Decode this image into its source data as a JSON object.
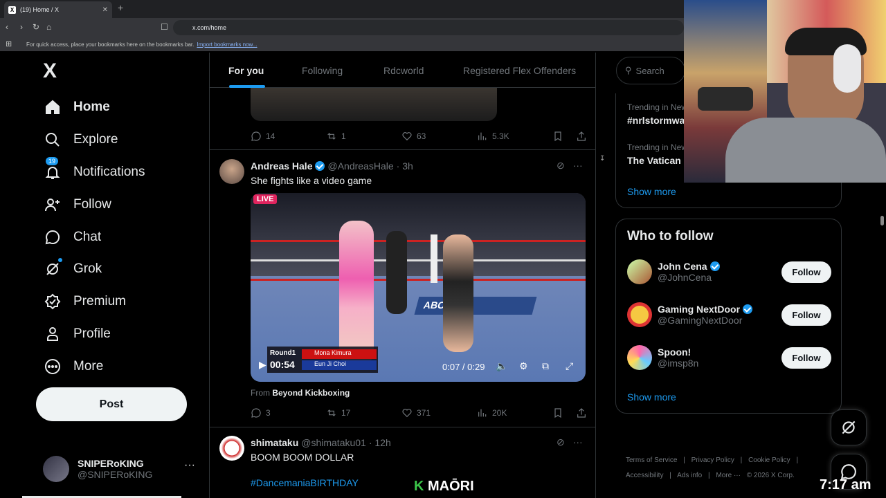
{
  "browser": {
    "tab_title": "(19) Home / X",
    "url": "x.com/home",
    "bookmarks_text": "For quick access, place your bookmarks here on the bookmarks bar.",
    "bookmarks_link": "Import bookmarks now..."
  },
  "nav": {
    "logo": "X",
    "items": [
      {
        "label": "Home",
        "icon": "home-icon"
      },
      {
        "label": "Explore",
        "icon": "search-icon"
      },
      {
        "label": "Notifications",
        "icon": "bell-icon",
        "badge": "19"
      },
      {
        "label": "Follow",
        "icon": "follow-icon"
      },
      {
        "label": "Chat",
        "icon": "chat-icon"
      },
      {
        "label": "Grok",
        "icon": "grok-icon"
      },
      {
        "label": "Premium",
        "icon": "premium-icon"
      },
      {
        "label": "Profile",
        "icon": "profile-icon"
      },
      {
        "label": "More",
        "icon": "more-icon"
      }
    ],
    "post_label": "Post",
    "account": {
      "name": "SNIPERoKING",
      "handle": "@SNIPERoKING"
    }
  },
  "timeline": {
    "tabs": [
      "For you",
      "Following",
      "Rdcworld",
      "Registered Flex Offenders"
    ],
    "post1_stats": {
      "replies": "14",
      "reposts": "1",
      "likes": "63",
      "views": "5.3K"
    },
    "post2": {
      "name": "Andreas Hale",
      "handle": "@AndreasHale",
      "time": "· 3h",
      "text": "She fights like a video game",
      "video": {
        "live": "LIVE",
        "round": "Round1",
        "timer": "00:54",
        "fighter1": "Mona Kimura",
        "fighter2": "Eun Ji Choi",
        "time_display": "0:07 / 0:29",
        "banner": "ABC"
      },
      "from_prefix": "From",
      "from_source": "Beyond Kickboxing",
      "stats": {
        "replies": "3",
        "reposts": "17",
        "likes": "371",
        "views": "20K"
      }
    },
    "post3": {
      "name": "shimataku",
      "handle": "@shimataku01",
      "time": "· 12h",
      "text": "BOOM BOOM DOLLAR",
      "hashtag": "#DancemaniaBIRTHDAY"
    }
  },
  "sidebar": {
    "search_placeholder": "Search",
    "trends": [
      {
        "context": "Trending in New",
        "name": "#nrlstormwa"
      },
      {
        "context": "Trending in New",
        "name": "The Vatican"
      }
    ],
    "show_more": "Show more",
    "who_to_follow_title": "Who to follow",
    "who_to_follow": [
      {
        "name": "John Cena",
        "handle": "@JohnCena",
        "verified": true
      },
      {
        "name": "Gaming NextDoor",
        "handle": "@GamingNextDoor",
        "verified": true
      },
      {
        "name": "Spoon!",
        "handle": "@imsp8n",
        "verified": false
      }
    ],
    "follow_label": "Follow",
    "show_more_2": "Show more",
    "footer": [
      "Terms of Service",
      "|",
      "Privacy Policy",
      "|",
      "Cookie Policy",
      "|",
      "Accessibility",
      "|",
      "Ads info",
      "|",
      "More ···",
      "© 2026 X Corp."
    ]
  },
  "overlay": {
    "clock": "7:17 am",
    "maori_k": "K",
    "maori_text": "MAŌRI"
  },
  "colors": {
    "accent": "#1d9bf0",
    "background": "#000000",
    "border": "#2f3336",
    "muted": "#71767b"
  }
}
